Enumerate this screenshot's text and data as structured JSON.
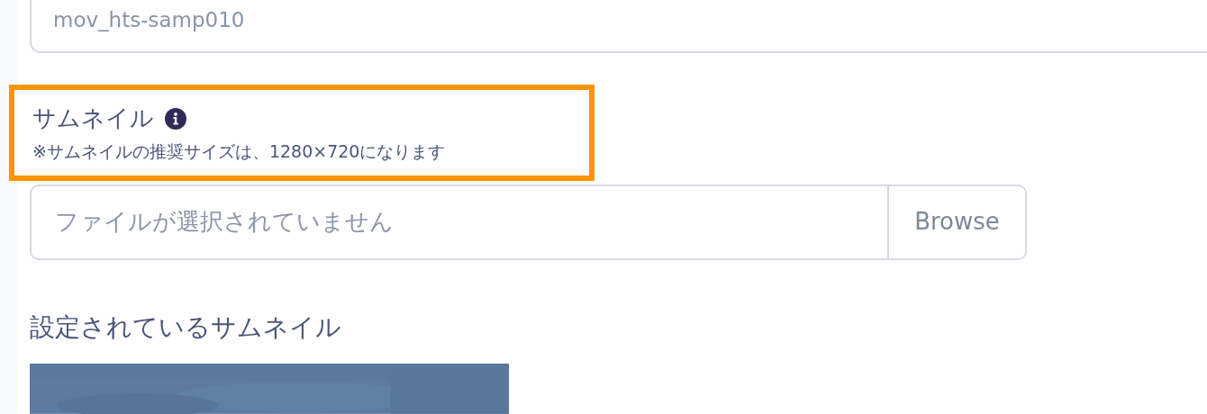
{
  "name_field": {
    "value": "mov_hts-samp010"
  },
  "thumbnail_field": {
    "label": "サムネイル",
    "hint": "※サムネイルの推奨サイズは、1280×720になります",
    "highlighted": true,
    "file_status": "ファイルが選択されていません",
    "browse_button": "Browse"
  },
  "current_thumbnail": {
    "heading": "設定されているサムネイル",
    "kind": "picture"
  }
}
